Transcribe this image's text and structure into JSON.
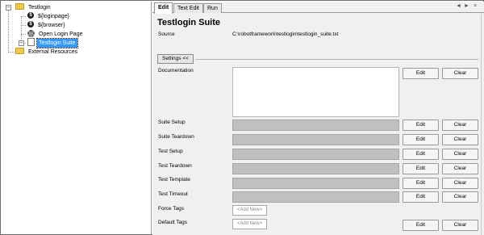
{
  "tree": {
    "root": "Testlogin",
    "items": [
      {
        "label": "${loginpage}",
        "icon": "variable-icon"
      },
      {
        "label": "${browser}",
        "icon": "variable-icon"
      },
      {
        "label": "Open Login Page",
        "icon": "keyword-icon"
      },
      {
        "label": "Testlogin Suite",
        "icon": "suite-file-icon",
        "selected": true
      }
    ],
    "external": "External Resources"
  },
  "tabs": [
    "Edit",
    "Text Edit",
    "Run"
  ],
  "tab_controls": {
    "prev": "◄",
    "next": "►",
    "close": "×"
  },
  "suite": {
    "title": "Testlogin Suite",
    "source_label": "Source",
    "source_value": "C:\\robotframework\\testlogin\\testlogin_suite.txt",
    "settings_button": "Settings <<"
  },
  "settings": [
    {
      "label": "Documentation"
    },
    {
      "label": "Suite Setup"
    },
    {
      "label": "Suite Teardown"
    },
    {
      "label": "Test Setup"
    },
    {
      "label": "Test Teardown"
    },
    {
      "label": "Test Template"
    },
    {
      "label": "Test Timeout"
    },
    {
      "label": "Force Tags",
      "placeholder": "<Add New>"
    },
    {
      "label": "Default Tags",
      "placeholder": "<Add New>"
    }
  ],
  "buttons": {
    "edit": "Edit",
    "clear": "Clear"
  },
  "colors": {
    "selection": "#3399ff",
    "field": "#c0c0c0",
    "folder": "#f2c94c"
  }
}
